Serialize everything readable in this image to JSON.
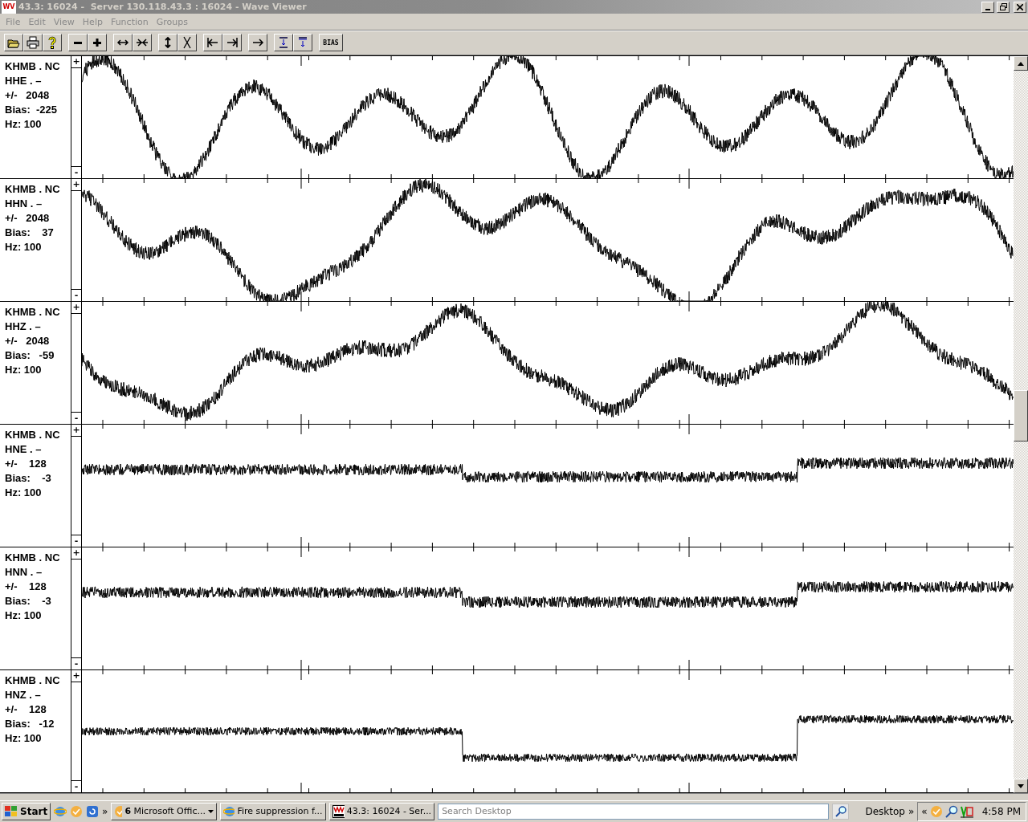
{
  "window": {
    "logo": "WV",
    "title": "43.3: 16024 -  Server 130.118.43.3 : 16024 - Wave Viewer"
  },
  "menu": [
    "File",
    "Edit",
    "View",
    "Help",
    "Function",
    "Groups"
  ],
  "toolbar": {
    "bias_button": "BIAS"
  },
  "channels": [
    {
      "station": "KHMB . NC",
      "component": "HHE . –",
      "range": "+/-   2048",
      "bias": "Bias:  -225",
      "rate": "Hz: 100",
      "scale_plus": "+",
      "scale_minus": "-"
    },
    {
      "station": "KHMB . NC",
      "component": "HHN . –",
      "range": "+/-   2048",
      "bias": "Bias:    37",
      "rate": "Hz: 100",
      "scale_plus": "+",
      "scale_minus": "-"
    },
    {
      "station": "KHMB . NC",
      "component": "HHZ . –",
      "range": "+/-   2048",
      "bias": "Bias:   -59",
      "rate": "Hz: 100",
      "scale_plus": "+",
      "scale_minus": "-"
    },
    {
      "station": "KHMB . NC",
      "component": "HNE . –",
      "range": "+/-    128",
      "bias": "Bias:    -3",
      "rate": "Hz: 100",
      "scale_plus": "+",
      "scale_minus": "-"
    },
    {
      "station": "KHMB . NC",
      "component": "HNN . –",
      "range": "+/-    128",
      "bias": "Bias:    -3",
      "rate": "Hz: 100",
      "scale_plus": "+",
      "scale_minus": "-"
    },
    {
      "station": "KHMB . NC",
      "component": "HNZ . –",
      "range": "+/-    128",
      "bias": "Bias:   -12",
      "rate": "Hz: 100",
      "scale_plus": "+",
      "scale_minus": "-"
    }
  ],
  "taskbar": {
    "start": "Start",
    "quick_launch_more": "»",
    "tasks": [
      {
        "label": "**6** Microsoft Offic...",
        "kind": "outlook",
        "dropdown": true
      },
      {
        "label": "Fire suppression f...",
        "kind": "browser",
        "dropdown": false
      },
      {
        "label": "43.3: 16024 - Ser...",
        "kind": "wave",
        "dropdown": false
      }
    ],
    "search": {
      "placeholder": "Search Desktop"
    },
    "desktop": "Desktop",
    "desktop_more": "»",
    "tray_expand": "«",
    "clock": "4:58 PM"
  }
}
